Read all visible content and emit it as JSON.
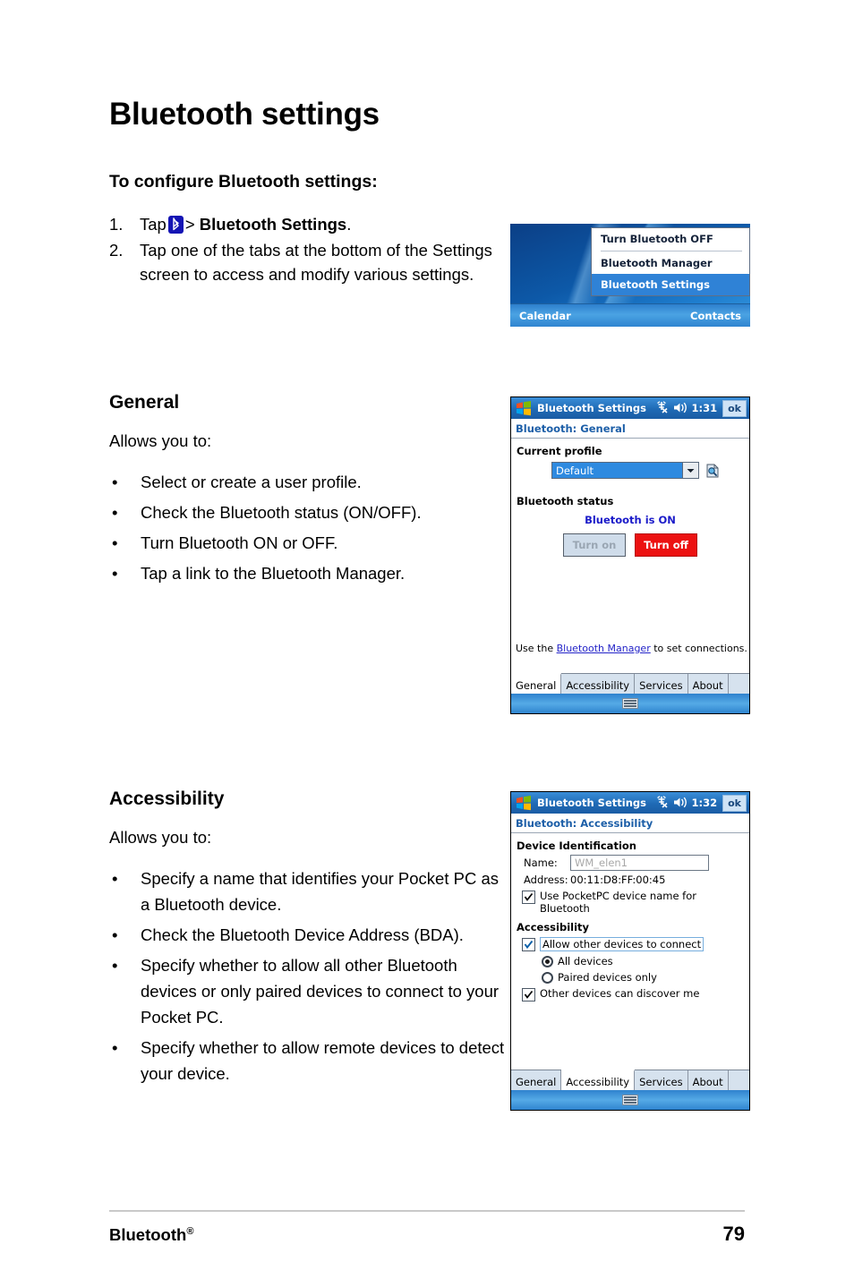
{
  "document": {
    "title": "Bluetooth settings",
    "subhead": "To configure Bluetooth settings:",
    "steps": [
      {
        "num": "1.",
        "pre": "Tap",
        "icon": "bluetooth-icon",
        "sep": ">",
        "bold": "Bluetooth Settings",
        "post": "."
      },
      {
        "num": "2.",
        "text": "Tap one of the tabs at the bottom of the Settings screen to access and modify various settings."
      }
    ],
    "sections": [
      {
        "heading": "General",
        "lead": "Allows you to:",
        "bullets": [
          "Select or create a user profile.",
          "Check the Bluetooth status (ON/OFF).",
          "Turn Bluetooth ON or OFF.",
          "Tap a link to the Bluetooth Manager."
        ]
      },
      {
        "heading": "Accessibility",
        "lead": "Allows you to:",
        "bullets": [
          "Specify a name that identifies your Pocket PC as a Bluetooth device.",
          "Check the Bluetooth Device Address (BDA).",
          "Specify whether to allow all other Bluetooth devices or only paired devices to connect to your Pocket PC.",
          "Specify whether to allow remote devices to detect your device."
        ]
      }
    ],
    "footer": {
      "left": "Bluetooth",
      "left_sup": "®",
      "page_number": "79"
    },
    "bullet_char": "•"
  },
  "screenshot_menu": {
    "menu_items": [
      {
        "label": "Turn Bluetooth OFF",
        "selected": false
      },
      {
        "label": "Bluetooth Manager",
        "selected": false
      },
      {
        "label": "Bluetooth Settings",
        "selected": true
      }
    ],
    "taskbar_left": "Calendar",
    "taskbar_right": "Contacts",
    "colors": {
      "selection": "#2f82d6",
      "wallpaper": "#0d59a8"
    }
  },
  "screenshot_general": {
    "titlebar": {
      "title": "Bluetooth Settings",
      "time": "1:31",
      "ok": "ok"
    },
    "subtitle": "Bluetooth: General",
    "profile_group_label": "Current profile",
    "profile_value": "Default",
    "status_group_label": "Bluetooth status",
    "status_text": "Bluetooth is ON",
    "btn_turn_on": "Turn on",
    "btn_turn_off": "Turn off",
    "hint_pre": "Use the ",
    "hint_link": "Bluetooth Manager",
    "hint_post": " to set connections.",
    "tabs": [
      {
        "label": "General",
        "active": true
      },
      {
        "label": "Accessibility",
        "active": false
      },
      {
        "label": "Services",
        "active": false
      },
      {
        "label": "About",
        "active": false
      }
    ],
    "colors": {
      "title_blue": "#1f6ab5",
      "status_blue": "#1b1bc9",
      "danger_red": "#ec1111",
      "link": "#2424c8"
    }
  },
  "screenshot_accessibility": {
    "titlebar": {
      "title": "Bluetooth Settings",
      "time": "1:32",
      "ok": "ok"
    },
    "subtitle": "Bluetooth: Accessibility",
    "group_device": "Device Identification",
    "name_label": "Name:",
    "name_value": "WM_elen1",
    "address_label": "Address:",
    "address_value": "00:11:D8:FF:00:45",
    "use_pocketpc_checkbox": {
      "label": "Use PocketPC device name for Bluetooth",
      "checked": true
    },
    "group_accessibility": "Accessibility",
    "allow_connect_checkbox": {
      "label": "Allow other devices to connect",
      "checked": true
    },
    "radios": [
      {
        "label": "All devices",
        "selected": true
      },
      {
        "label": "Paired devices only",
        "selected": false
      }
    ],
    "discover_checkbox": {
      "label": "Other devices can discover me",
      "checked": true
    },
    "tabs": [
      {
        "label": "General",
        "active": false
      },
      {
        "label": "Accessibility",
        "active": true
      },
      {
        "label": "Services",
        "active": false
      },
      {
        "label": "About",
        "active": false
      }
    ]
  }
}
